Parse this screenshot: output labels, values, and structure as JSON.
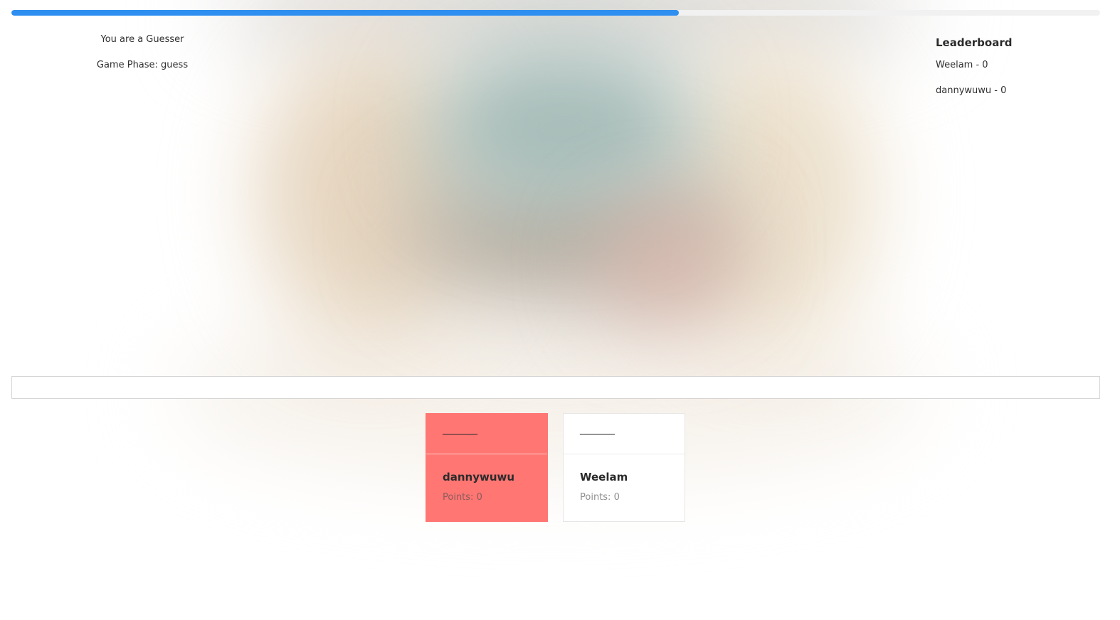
{
  "progress": {
    "fraction": 0.613,
    "fill_color": "#2f8ff0",
    "track_color": "#f1f1f1"
  },
  "role": {
    "role_text": "You are a Guesser",
    "phase_text": "Game Phase: guess"
  },
  "leaderboard": {
    "title": "Leaderboard",
    "entries": [
      {
        "text": "Weelam - 0"
      },
      {
        "text": "dannywuwu - 0"
      }
    ]
  },
  "guess": {
    "value": "",
    "placeholder": ""
  },
  "players": [
    {
      "word_blank": "________",
      "name": "dannywuwu",
      "points": "Points: 0",
      "highlight_color": "#ff7673"
    },
    {
      "word_blank": "________",
      "name": "Weelam",
      "points": "Points: 0"
    }
  ]
}
